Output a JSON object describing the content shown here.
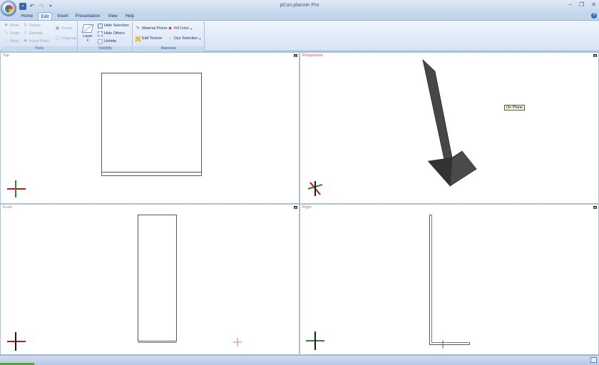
{
  "app": {
    "title": "pCon.planner Pro"
  },
  "tabs": [
    "Home",
    "Edit",
    "Insert",
    "Presentation",
    "View",
    "Help"
  ],
  "active_tab": "Edit",
  "ribbon": {
    "tools": {
      "label": "Tools",
      "move": "Move",
      "rotate": "Rotate",
      "scale": "Scale",
      "extrude": "Extrude",
      "array": "Array",
      "insert_point": "Insert Point",
      "group": "Group",
      "ungroup": "Ungroup"
    },
    "visibility": {
      "label": "Visibility",
      "layer": "Layer",
      "hide_selection": "Hide Selection",
      "hide_others": "Hide Others",
      "unhide": "Unhide"
    },
    "materials": {
      "label": "Materials",
      "material_picker": "Material Picker",
      "fill_color": "Fill Color",
      "edit_texture": "Edit Texture",
      "dye_selection": "Dye Selection"
    }
  },
  "viewports": {
    "top": {
      "label": "Top"
    },
    "perspective": {
      "label": "Perspective"
    },
    "front": {
      "label": "Front"
    },
    "right": {
      "label": "Right"
    }
  },
  "tooltip": {
    "text": "On Plane"
  },
  "colors": {
    "active_view_label": "#d9534f",
    "object_fill": "#3f3f3f",
    "axis_red": "#c0161b",
    "axis_green": "#2f8a2f",
    "axis_navy": "#10163f"
  }
}
